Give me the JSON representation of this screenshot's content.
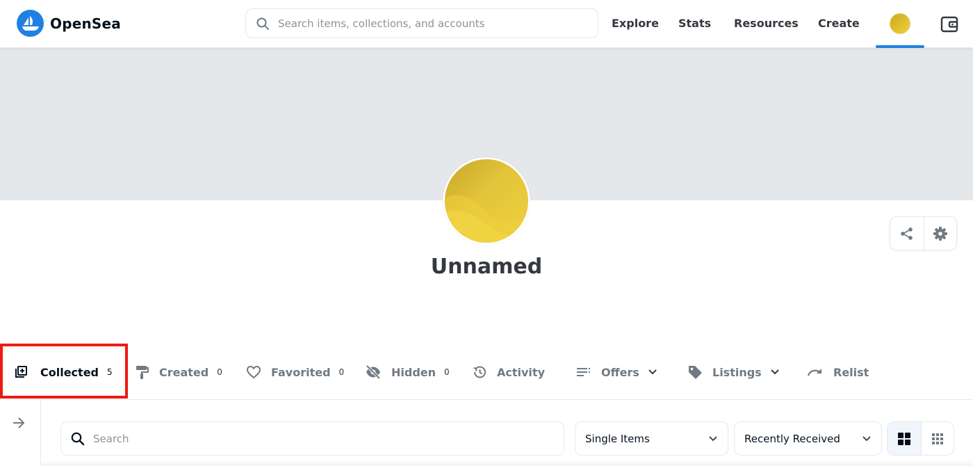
{
  "header": {
    "brand": "OpenSea",
    "search_placeholder": "Search items, collections, and accounts",
    "nav": {
      "explore": "Explore",
      "stats": "Stats",
      "resources": "Resources",
      "create": "Create"
    },
    "icons": {
      "search": "search-icon",
      "avatar": "user-avatar",
      "wallet": "wallet-icon"
    }
  },
  "profile": {
    "name": "Unnamed",
    "actions": [
      "share-icon",
      "gear-icon"
    ]
  },
  "tabs": {
    "collected": {
      "label": "Collected",
      "count": "5"
    },
    "created": {
      "label": "Created",
      "count": "0"
    },
    "favorited": {
      "label": "Favorited",
      "count": "0"
    },
    "hidden": {
      "label": "Hidden",
      "count": "0"
    },
    "activity": {
      "label": "Activity"
    },
    "offers": {
      "label": "Offers"
    },
    "listings": {
      "label": "Listings"
    },
    "relist": {
      "label": "Relist"
    }
  },
  "filters": {
    "search_placeholder": "Search",
    "item_type": "Single Items",
    "sort": "Recently Received",
    "view_modes": [
      "grid-large-icon",
      "grid-small-icon"
    ]
  },
  "colors": {
    "accent": "#2081e2",
    "highlight": "#ee1b12",
    "banner": "#e5e8eb",
    "avatar": "#e3c53a"
  }
}
